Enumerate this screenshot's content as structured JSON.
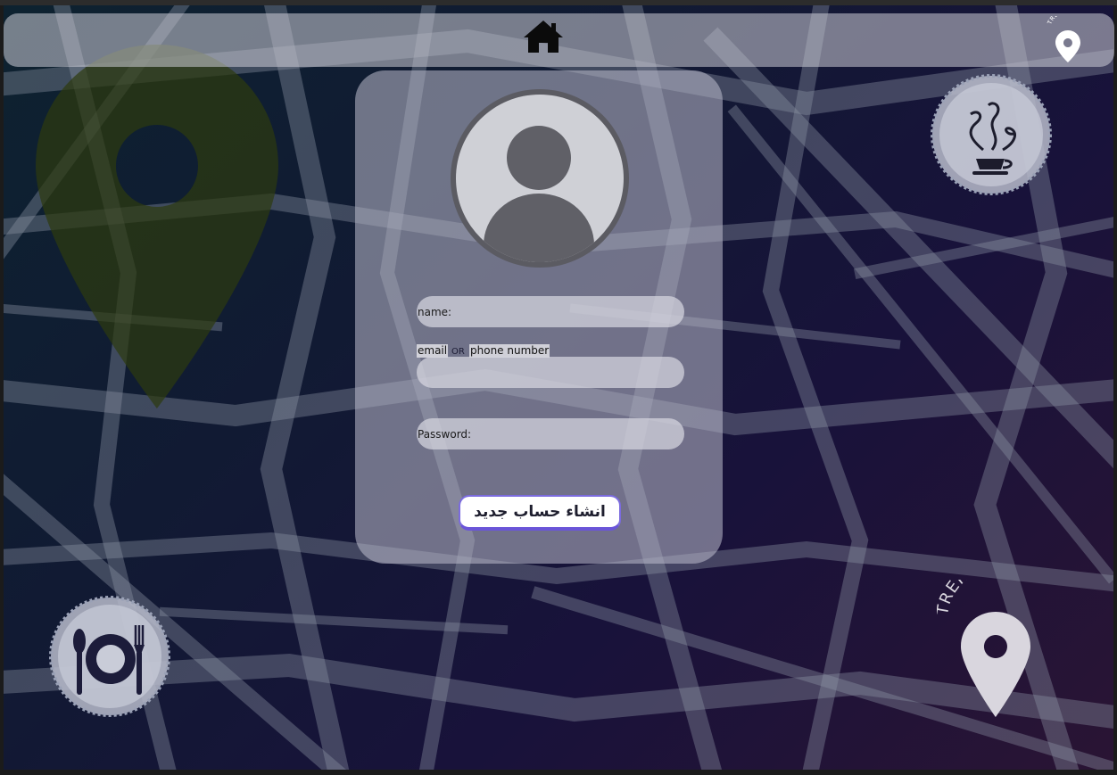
{
  "navbar": {
    "home_icon": "home-icon",
    "logo_text": "TRENDMAP"
  },
  "signup_form": {
    "name_label": "name:",
    "email_tag": "email",
    "or_text": "OR",
    "phone_tag": "phone number",
    "password_label": "Password:",
    "submit_label": "انشاء حساب جديد"
  },
  "brand": {
    "logo_text": "TRENDMAP"
  },
  "colors": {
    "accent": "#7b6bde",
    "pin_large": "#2e3a0e",
    "pin_logo": "#d9d6de"
  }
}
